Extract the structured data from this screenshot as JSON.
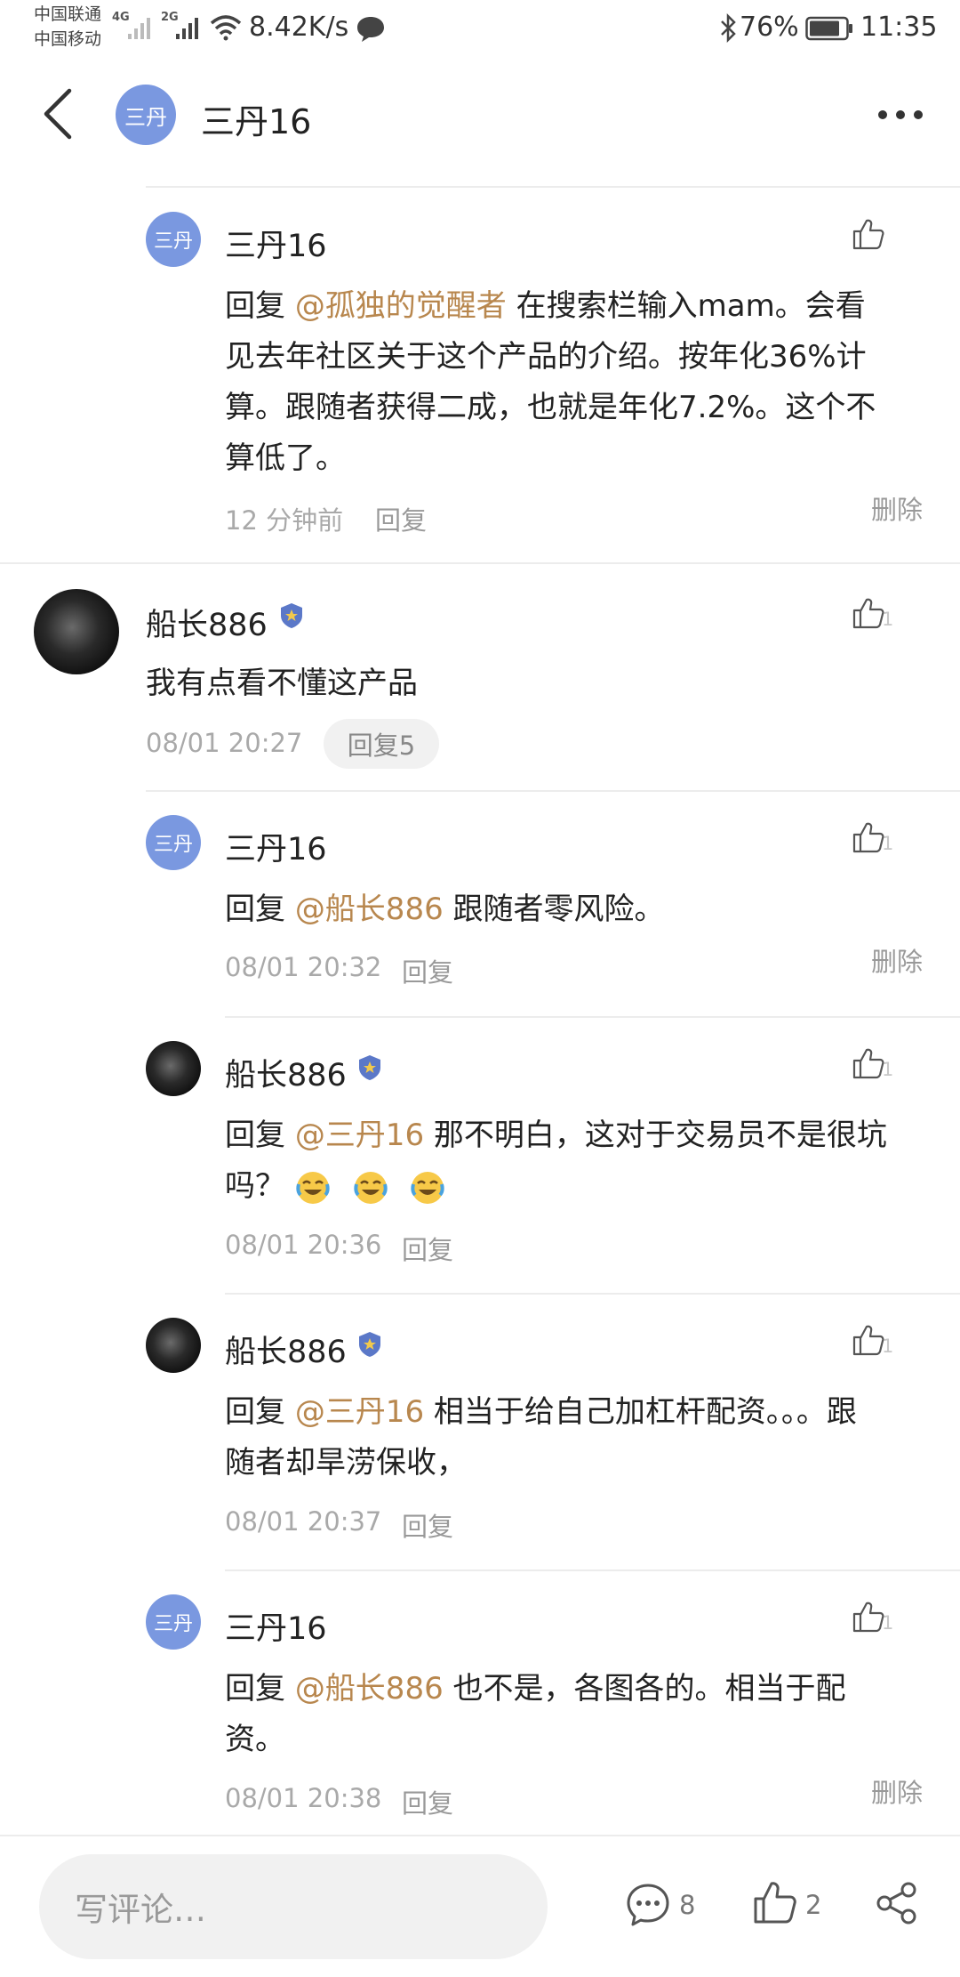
{
  "status_bar": {
    "carrier_1": "中国联通",
    "carrier_2": "中国移动",
    "net_1": "4G",
    "net_2": "2G",
    "speed": "8.42K/s",
    "battery": "76%",
    "time": "11:35"
  },
  "header": {
    "avatar_text": "三丹",
    "title": "三丹16"
  },
  "comments": [
    {
      "avatar_text": "三丹",
      "username": "三丹16",
      "prefix": "回复 ",
      "mention": "@孤独的觉醒者",
      "line1_rest": " 在搜索栏输入mam。会看",
      "line2": "见去年社区关于这个产品的介绍。按年化36%计",
      "line3": "算。跟随者获得二成，也就是年化7.2%。这个不",
      "line4": "算低了。",
      "time": "12 分钟前",
      "reply": "回复",
      "delete": "删除"
    },
    {
      "username": "船长886",
      "text": "我有点看不懂这产品",
      "time": "08/01 20:27",
      "reply_count": "回复5",
      "likes": "1"
    },
    {
      "avatar_text": "三丹",
      "username": "三丹16",
      "prefix": "回复 ",
      "mention": "@船长886",
      "text": " 跟随者零风险。",
      "time": "08/01 20:32",
      "reply": "回复",
      "delete": "删除",
      "likes": "1"
    },
    {
      "username": "船长886",
      "prefix": "回复 ",
      "mention": "@三丹16",
      "line1_rest": " 那不明白，这对于交易员不是很坑",
      "line2": "吗？",
      "time": "08/01 20:36",
      "reply": "回复",
      "likes": "1"
    },
    {
      "username": "船长886",
      "prefix": "回复 ",
      "mention": "@三丹16",
      "line1_rest": " 相当于给自己加杠杆配资。。。跟",
      "line2": "随者却旱涝保收，",
      "time": "08/01 20:37",
      "reply": "回复",
      "likes": "1"
    },
    {
      "avatar_text": "三丹",
      "username": "三丹16",
      "prefix": "回复 ",
      "mention": "@船长886",
      "line1_rest": " 也不是，各图各的。相当于配",
      "line2": "资。",
      "time": "08/01 20:38",
      "reply": "回复",
      "delete": "删除",
      "likes": "1"
    }
  ],
  "bottom_bar": {
    "placeholder": "写评论…",
    "comment_count": "8",
    "like_count": "2"
  },
  "colors": {
    "mention": "#b8874e",
    "avatar_blue": "#7a98e0"
  },
  "icons": [
    "back-icon",
    "more-icon",
    "thumbs-up-icon",
    "police-badge-icon",
    "laughing-emoji-icon",
    "comment-icon",
    "share-icon",
    "bluetooth-icon",
    "wifi-icon",
    "battery-icon",
    "message-icon"
  ]
}
